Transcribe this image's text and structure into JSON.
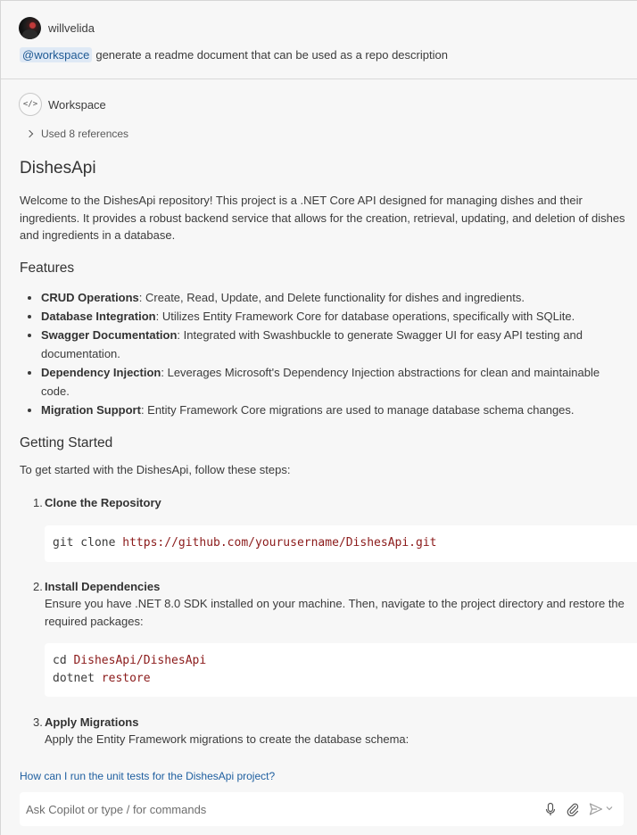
{
  "user": {
    "name": "willvelida",
    "mention": "@workspace",
    "prompt": "generate a readme document that can be used as a repo description"
  },
  "response": {
    "agent_label": "Workspace",
    "agent_icon": "code-icon",
    "references_label": "Used 8 references",
    "title": "DishesApi",
    "intro": "Welcome to the DishesApi repository! This project is a .NET Core API designed for managing dishes and their ingredients. It provides a robust backend service that allows for the creation, retrieval, updating, and deletion of dishes and ingredients in a database.",
    "features_heading": "Features",
    "features": [
      {
        "name": "CRUD Operations",
        "text": ": Create, Read, Update, and Delete functionality for dishes and ingredients."
      },
      {
        "name": "Database Integration",
        "text": ": Utilizes Entity Framework Core for database operations, specifically with SQLite."
      },
      {
        "name": "Swagger Documentation",
        "text": ": Integrated with Swashbuckle to generate Swagger UI for easy API testing and documentation."
      },
      {
        "name": "Dependency Injection",
        "text": ": Leverages Microsoft's Dependency Injection abstractions for clean and maintainable code."
      },
      {
        "name": "Migration Support",
        "text": ": Entity Framework Core migrations are used to manage database schema changes."
      }
    ],
    "getting_started_heading": "Getting Started",
    "steps_intro": "To get started with the DishesApi, follow these steps:",
    "steps": [
      {
        "num": "1.",
        "title": "Clone the Repository",
        "desc": ""
      },
      {
        "num": "2.",
        "title": "Install Dependencies",
        "desc": "Ensure you have .NET 8.0 SDK installed on your machine. Then, navigate to the project directory and restore the required packages:"
      },
      {
        "num": "3.",
        "title": "Apply Migrations",
        "desc": "Apply the Entity Framework migrations to create the database schema:"
      }
    ],
    "code1": {
      "cmd": "git clone",
      "arg": "https://github.com/yourusername/DishesApi.git"
    },
    "code2": [
      {
        "cmd": "cd",
        "arg": "DishesApi/DishesApi"
      },
      {
        "cmd": "dotnet",
        "arg": "restore"
      }
    ]
  },
  "suggestion": "How can I run the unit tests for the DishesApi project?",
  "input": {
    "placeholder": "Ask Copilot or type / for commands",
    "value": ""
  },
  "colors": {
    "mention_bg": "#dfe9f5",
    "link": "#1f5fa0",
    "code_arg": "#8b1a1a"
  }
}
